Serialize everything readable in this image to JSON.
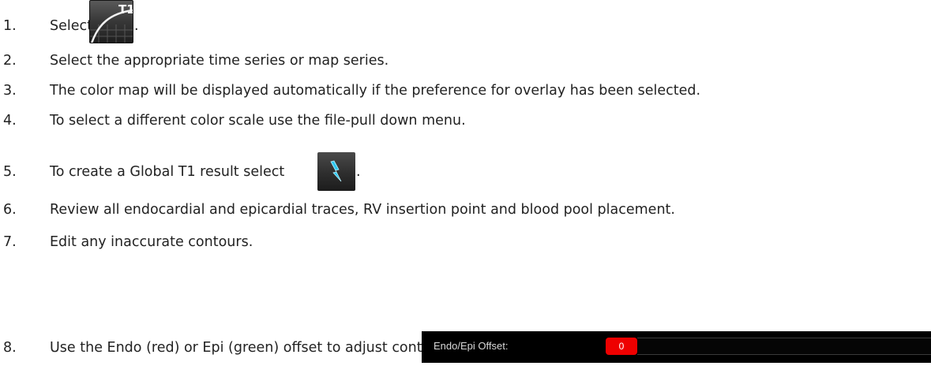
{
  "steps": [
    {
      "num": "1.",
      "text": "Select",
      "suffix": "."
    },
    {
      "num": "2.",
      "text": "Select the appropriate time series or map series."
    },
    {
      "num": "3.",
      "text": "The color map will be displayed automatically if the preference for overlay has been selected."
    },
    {
      "num": "4.",
      "text": "To select a different color scale use the file-pull down menu."
    },
    {
      "num": "5.",
      "text": "To create a Global T1 result select",
      "suffix": "."
    },
    {
      "num": "6.",
      "text": "Review all endocardial and epicardial traces, RV insertion point and blood pool placement."
    },
    {
      "num": "7.",
      "text": "Edit any inaccurate contours."
    },
    {
      "num": "8.",
      "text": "Use the Endo (red) or Epi (green) offset to adjust contours"
    }
  ],
  "t1_icon": {
    "label": "T1",
    "icon": "t1-map-icon"
  },
  "bolt_icon": {
    "icon": "lightning-icon",
    "color": "#2ec8f0"
  },
  "offset_widget": {
    "label": "Endo/Epi Offset:",
    "value": "0",
    "value_color": "#ee0000"
  }
}
